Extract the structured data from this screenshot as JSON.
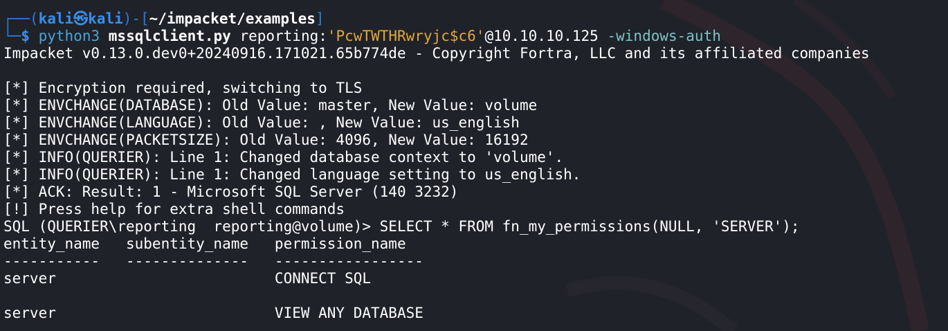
{
  "prompt": {
    "corner_top": "┌──(",
    "user": "kali",
    "at_symbol": "㉿",
    "host": "kali",
    "sep": ")-[",
    "path": "~/impacket/examples",
    "close": "]",
    "corner_bottom": "└─",
    "dollar": "$"
  },
  "command": {
    "program": "python3",
    "script": "mssqlclient.py",
    "target_user": "reporting:",
    "password": "'PcwTWTHRwryjc$c6'",
    "host": "@10.10.10.125",
    "flag": "-windows-auth"
  },
  "output": {
    "banner": "Impacket v0.13.0.dev0+20240916.171021.65b774de - Copyright Fortra, LLC and its affiliated companies",
    "messages": [
      "[*] Encryption required, switching to TLS",
      "[*] ENVCHANGE(DATABASE): Old Value: master, New Value: volume",
      "[*] ENVCHANGE(LANGUAGE): Old Value: , New Value: us_english",
      "[*] ENVCHANGE(PACKETSIZE): Old Value: 4096, New Value: 16192",
      "[*] INFO(QUERIER): Line 1: Changed database context to 'volume'.",
      "[*] INFO(QUERIER): Line 1: Changed language setting to us_english.",
      "[*] ACK: Result: 1 - Microsoft SQL Server (140 3232)",
      "[!] Press help for extra shell commands"
    ],
    "sql_prompt": "SQL (QUERIER\\reporting  reporting@volume)> SELECT * FROM fn_my_permissions(NULL, 'SERVER');",
    "table_header": "entity_name   subentity_name   permission_name",
    "table_divider": "-----------   --------------   -----------------",
    "rows": [
      "server                         CONNECT SQL",
      "server                         VIEW ANY DATABASE"
    ]
  },
  "colors": {
    "background": "#1f2229",
    "prompt_blue": "#3b8eea",
    "password_orange": "#e5a63a",
    "flag_teal": "#7ec2c6"
  }
}
